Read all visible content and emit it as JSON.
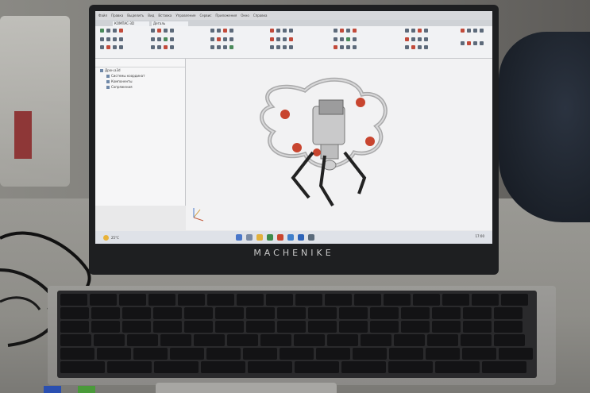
{
  "laptop": {
    "brand": "MACHENIKE"
  },
  "app": {
    "menu": [
      "Файл",
      "Правка",
      "Выделить",
      "Вид",
      "Вставка",
      "Управление",
      "Сервис",
      "Приложения",
      "Окно",
      "Справка"
    ],
    "tabs": [
      "КОМПАС-3D",
      "Деталь"
    ],
    "tree_items": [
      "Дрон.a3d",
      "Системы координат",
      "Компоненты",
      "Сопряжения"
    ],
    "taskbar_left": "25°C",
    "taskbar_right": "17:00"
  }
}
